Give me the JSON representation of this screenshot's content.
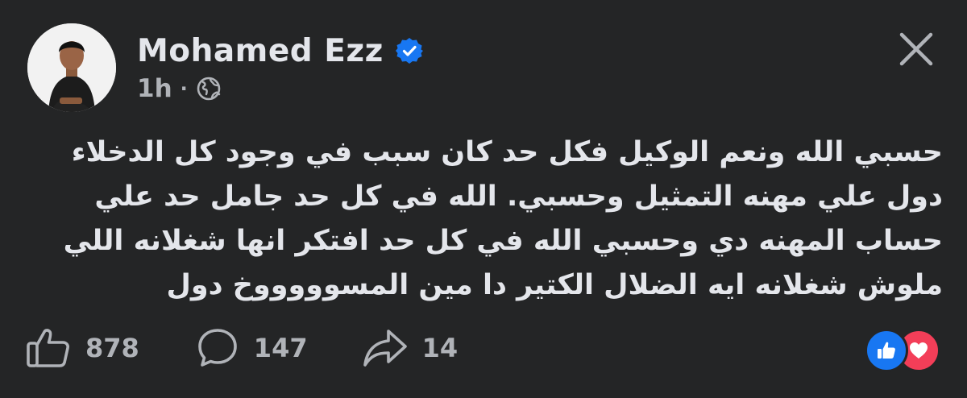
{
  "post": {
    "author": {
      "name": "Mohamed Ezz",
      "verified": true,
      "avatar": "profile-photo"
    },
    "time": "1h",
    "separator": "·",
    "audience_icon": "globe-icon",
    "close_icon": "close-icon",
    "text_lines": [
      "حسبي الله ونعم الوكيل فكل حد كان سبب في وجود كل الدخلاء",
      "دول علي مهنه التمثيل وحسبي. الله في كل حد جامل حد علي",
      "حساب المهنه دي وحسبي الله في كل حد افتكر انها شغلانه اللي",
      "ملوش شغلانه ايه  الضلال الكتير دا  مين المسوووووخ دول"
    ],
    "stats": {
      "likes": "878",
      "comments": "147",
      "shares": "14"
    },
    "reactions": [
      "like",
      "love"
    ]
  },
  "colors": {
    "background": "#242526",
    "text": "#e4e6eb",
    "secondary": "#b0b3b8",
    "verified": "#1877f2",
    "like": "#1877f2",
    "love": "#f33e58"
  }
}
